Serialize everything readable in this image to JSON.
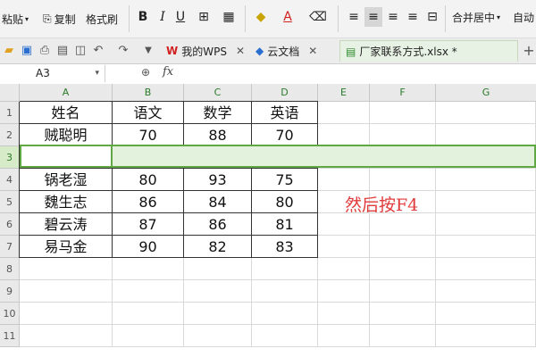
{
  "toolbar": {
    "paste_label": "粘贴",
    "copy_label": "复制",
    "format_painter_label": "格式刷",
    "bold_label": "B",
    "italic_label": "I",
    "underline_label": "U",
    "merge_center_label": "合并居中",
    "auto_wrap_label": "自动"
  },
  "tabs": [
    {
      "label": "我的WPS"
    },
    {
      "label": "云文档"
    },
    {
      "label": "厂家联系方式.xlsx *"
    }
  ],
  "formula_bar": {
    "name_box": "A3",
    "fx_label": "fx",
    "value": ""
  },
  "columns": [
    "A",
    "B",
    "C",
    "D",
    "E",
    "F",
    "G"
  ],
  "rows": [
    "1",
    "2",
    "3",
    "4",
    "5",
    "6",
    "7",
    "8",
    "9",
    "10",
    "11"
  ],
  "table": {
    "row1": [
      "姓名",
      "语文",
      "数学",
      "英语"
    ],
    "row2": [
      "贼聪明",
      "70",
      "88",
      "70"
    ],
    "row3": [
      "",
      "",
      "",
      ""
    ],
    "row4": [
      "锅老湿",
      "80",
      "93",
      "75"
    ],
    "row5": [
      "魏生志",
      "86",
      "84",
      "80"
    ],
    "row6": [
      "碧云涛",
      "87",
      "86",
      "81"
    ],
    "row7": [
      "易马金",
      "90",
      "82",
      "83"
    ]
  },
  "annotation": "然后按F4",
  "colors": {
    "accent": "#5fa844",
    "annotation": "#e03a3a",
    "selected_row_fill": "#e3f2dc"
  }
}
